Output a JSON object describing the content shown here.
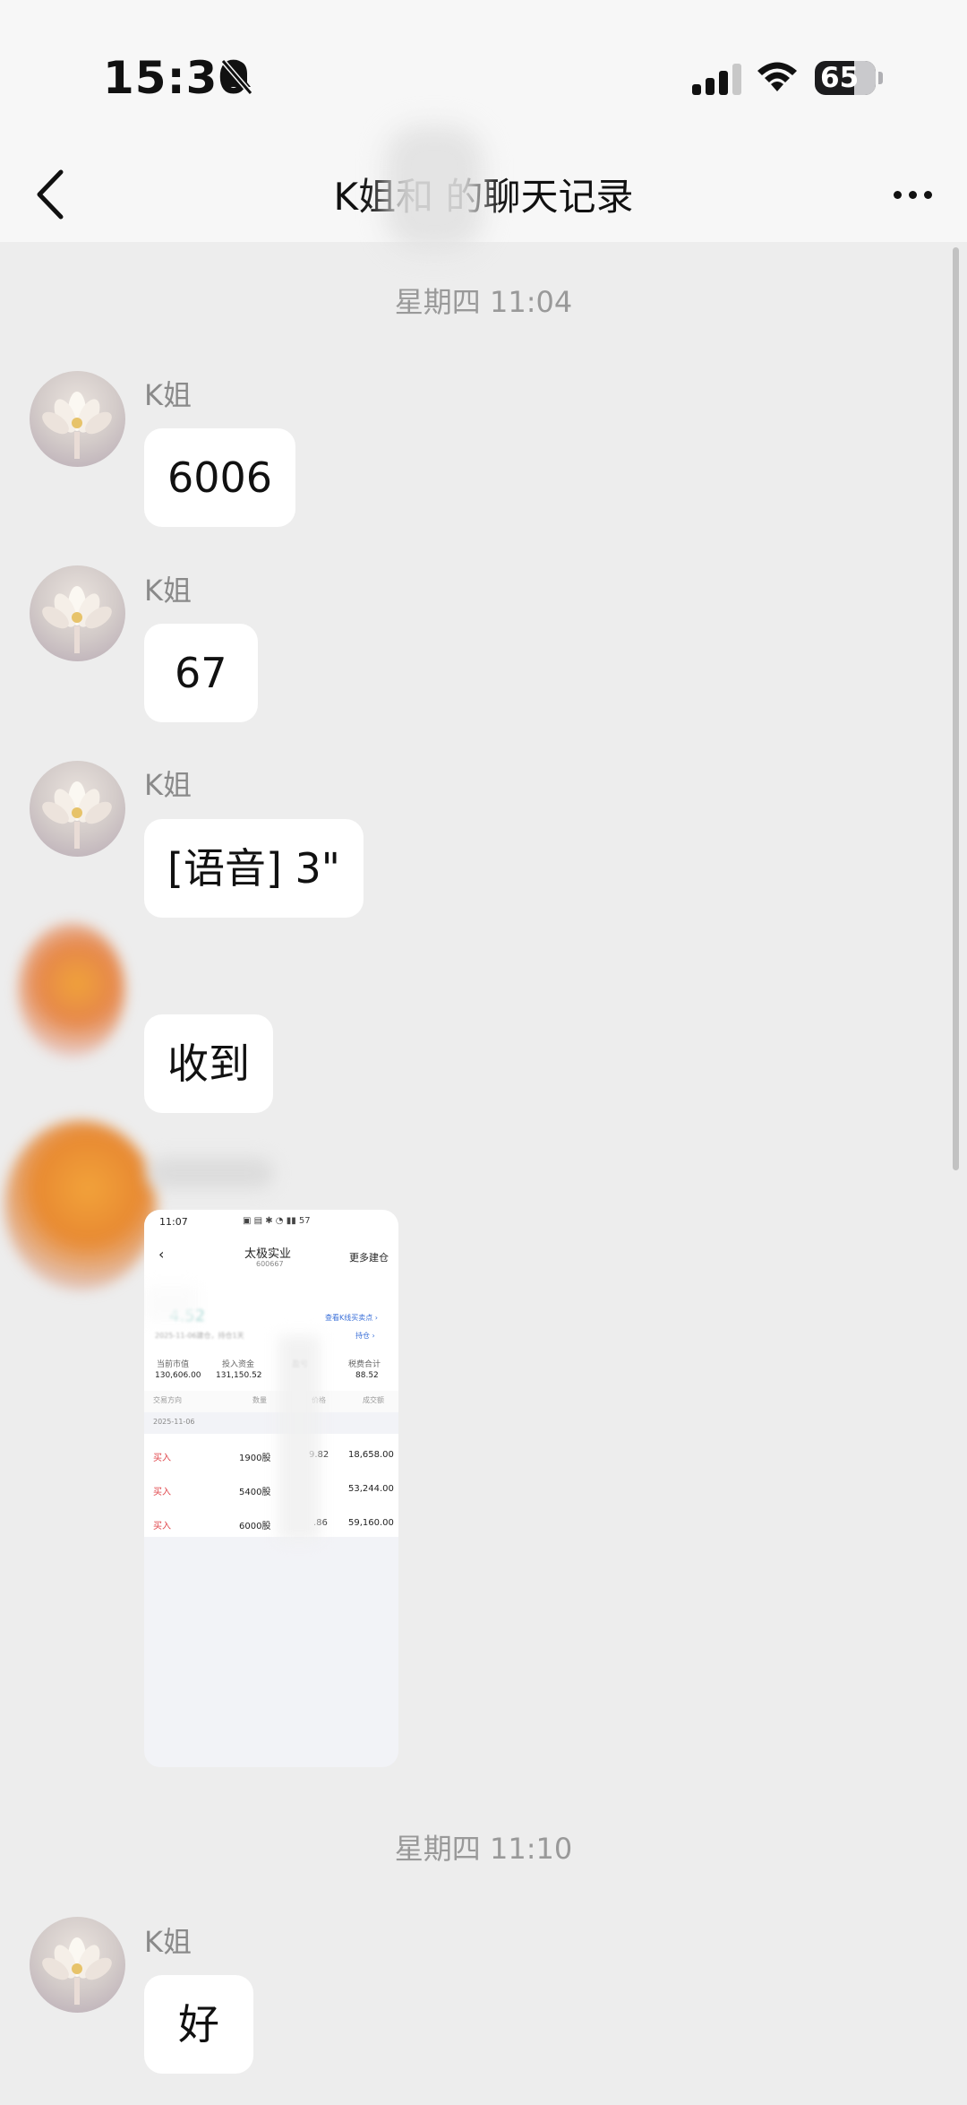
{
  "status_bar": {
    "time": "15:30",
    "battery": "65"
  },
  "header": {
    "title": "K姐和 的聊天记录"
  },
  "messages": [
    {
      "timestamp": "星期四 11:04"
    },
    {
      "sender": "K姐",
      "text": "6006"
    },
    {
      "sender": "K姐",
      "text": "67"
    },
    {
      "sender": "K姐",
      "text": "[语音] 3\""
    },
    {
      "text": "收到"
    },
    {
      "timestamp": "星期四 11:10"
    },
    {
      "sender": "K姐",
      "text": "好"
    }
  ],
  "screenshot": {
    "time": "11:07",
    "title": "太极实业",
    "code": "600667",
    "more": "更多建仓",
    "link": "查看K线买卖点 ›",
    "price": "4.52",
    "date_note": "2025-11-06建仓，持仓1天",
    "sub_link": "持仓 ›",
    "stats": [
      {
        "label": "当前市值",
        "value": "130,606.00"
      },
      {
        "label": "投入资金",
        "value": "131,150.52"
      },
      {
        "label": "盈亏",
        "value": ""
      },
      {
        "label": "税费合计",
        "value": "88.52"
      }
    ],
    "columns": [
      "交易方向",
      "数量",
      "价格",
      "成交额"
    ],
    "date": "2025-11-06",
    "rows": [
      {
        "dir": "买入",
        "qty": "1900股",
        "price": "9.82",
        "amount": "18,658.00"
      },
      {
        "dir": "买入",
        "qty": "5400股",
        "price": "",
        "amount": "53,244.00"
      },
      {
        "dir": "买入",
        "qty": "6000股",
        "price": ".86",
        "amount": "59,160.00"
      }
    ]
  },
  "colors": {
    "background": "#ededed",
    "bubble": "#ffffff",
    "buy": "#e0454a"
  }
}
